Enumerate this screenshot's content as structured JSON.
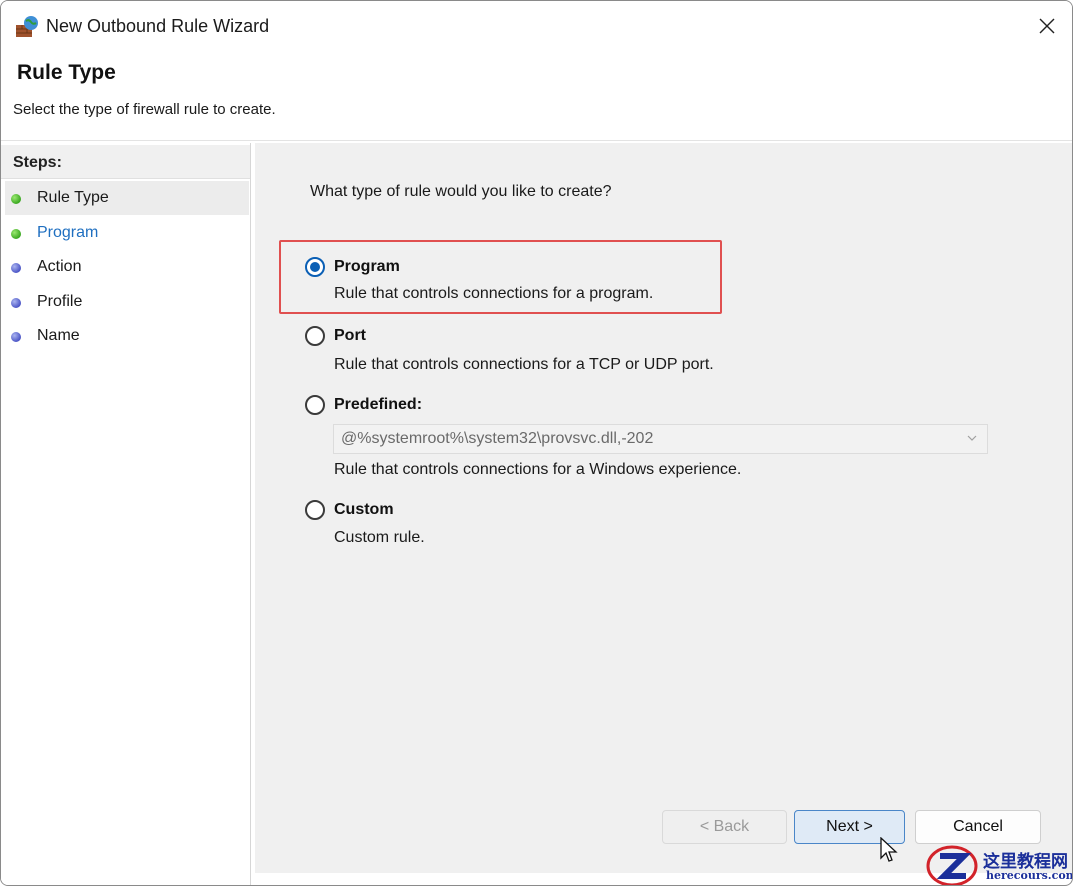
{
  "window": {
    "title": "New Outbound Rule Wizard",
    "icons": {
      "app": "firewall-icon",
      "close": "close-icon"
    }
  },
  "header": {
    "title": "Rule Type",
    "description": "Select the type of firewall rule to create."
  },
  "steps": {
    "heading": "Steps:",
    "items": [
      {
        "label": "Rule Type",
        "status": "done",
        "dot_color": "#3aa820"
      },
      {
        "label": "Program",
        "status": "done",
        "dot_color": "#3aa820"
      },
      {
        "label": "Action",
        "status": "pending",
        "dot_color": "#4b55c6"
      },
      {
        "label": "Profile",
        "status": "pending",
        "dot_color": "#4b55c6"
      },
      {
        "label": "Name",
        "status": "pending",
        "dot_color": "#4b55c6"
      }
    ]
  },
  "content": {
    "question": "What type of rule would you like to create?",
    "options": [
      {
        "label": "Program",
        "description": "Rule that controls connections for a program.",
        "selected": true
      },
      {
        "label": "Port",
        "description": "Rule that controls connections for a TCP or UDP port.",
        "selected": false
      },
      {
        "label": "Predefined:",
        "description": "Rule that controls connections for a Windows experience.",
        "selected": false
      },
      {
        "label": "Custom",
        "description": "Custom rule.",
        "selected": false
      }
    ],
    "predefined_select": {
      "value": "@%systemroot%\\system32\\provsvc.dll,-202",
      "disabled": true
    }
  },
  "buttons": {
    "back": "< Back",
    "next": "Next >",
    "cancel": "Cancel"
  },
  "watermark": {
    "cn": "这里教程网",
    "en": "herecours.com"
  },
  "colors": {
    "accent": "#0a5fb5",
    "highlight_box": "#e05050",
    "link": "#1f6fc0"
  }
}
